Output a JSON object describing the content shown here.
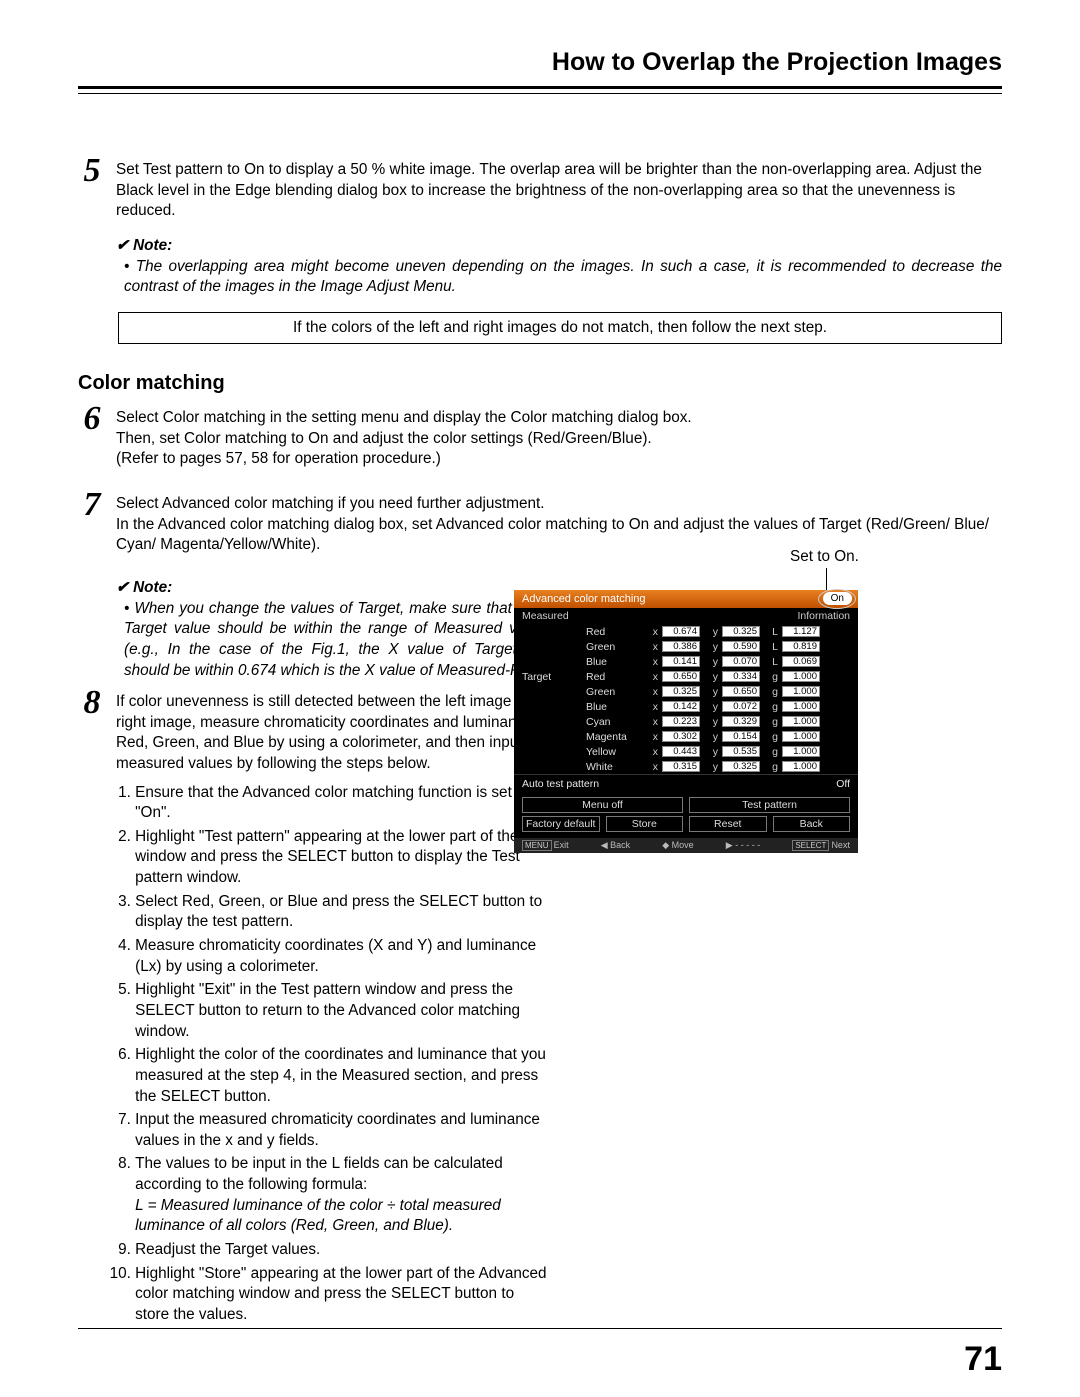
{
  "header": {
    "title": "How to Overlap the Projection Images"
  },
  "page_number": "71",
  "step5": {
    "num": "5",
    "body": "Set Test pattern to On to display a 50 % white image. The overlap area will be brighter than the non-overlapping area. Adjust the Black level in the Edge blending dialog box to increase the brightness of the non-overlapping area so that the unevenness is reduced."
  },
  "note5": {
    "heading": "Note:",
    "body": "The overlapping area might become uneven depending on the images. In such a case, it is recommended to decrease the contrast of the images in the Image Adjust Menu."
  },
  "boxed": "If the colors of the left and right images do not match, then follow the next step.",
  "section_color": "Color matching",
  "step6": {
    "num": "6",
    "body1": "Select Color matching in the setting menu and display the Color matching dialog box.",
    "body2": "Then, set Color matching to On and adjust the color settings (Red/Green/Blue).",
    "body3": "(Refer to pages 57, 58 for operation procedure.)"
  },
  "step7": {
    "num": "7",
    "body1": "Select Advanced color matching if you need further adjustment.",
    "body2": "In the Advanced color matching dialog box, set Advanced color matching to On and adjust the values of Target (Red/Green/ Blue/ Cyan/ Magenta/Yellow/White)."
  },
  "note7": {
    "heading": "Note:",
    "body": "When you change the values of Target, make sure that each Target value should be within the range of Measured value. (e.g., In the case of the Fig.1, the X value of Target-Red should be within 0.674 which is the X value of Measured-Red.)"
  },
  "step8": {
    "num": "8",
    "intro": "If color unevenness is still detected between the left image and right image, measure chromaticity coordinates and luminance of Red, Green, and Blue by using a colorimeter, and then input the measured values by following the steps below.",
    "list": [
      "Ensure that the Advanced color matching function is set to \"On\".",
      "Highlight \"Test pattern\" appearing at the lower part of the window and press the SELECT button to display the Test pattern window.",
      "Select Red, Green, or Blue and press the SELECT button to display the test pattern.",
      "Measure chromaticity coordinates (X and Y) and luminance (Lx) by using a colorimeter.",
      "Highlight \"Exit\" in the Test pattern window and press the SELECT button to return to the Advanced color matching window.",
      "Highlight the color of the coordinates and luminance that you measured at the step 4, in the Measured section, and press the SELECT button.",
      "Input the measured chromaticity coordinates and luminance values in the x and y fields.",
      "The values to be input in the L fields can be calculated according to the following formula:",
      "Readjust the Target values.",
      "Highlight \"Store\" appearing at the lower part of the Advanced color matching window and press the SELECT button to store the values."
    ],
    "formula": "L = Measured luminance of the color ÷ total measured luminance of all colors (Red, Green, and Blue)."
  },
  "figure": {
    "set_on": "Set to On.",
    "title": "Advanced color matching",
    "on_label": "On",
    "sub_left": "Measured",
    "sub_right": "Information",
    "measured": [
      {
        "name": "Red",
        "x": "0.674",
        "y": "0.325",
        "lab": "L",
        "l": "1.127"
      },
      {
        "name": "Green",
        "x": "0.386",
        "y": "0.590",
        "lab": "L",
        "l": "0.819"
      },
      {
        "name": "Blue",
        "x": "0.141",
        "y": "0.070",
        "lab": "L",
        "l": "0.069"
      }
    ],
    "target_label": "Target",
    "target": [
      {
        "name": "Red",
        "x": "0.650",
        "y": "0.334",
        "lab": "g",
        "l": "1.000"
      },
      {
        "name": "Green",
        "x": "0.325",
        "y": "0.650",
        "lab": "g",
        "l": "1.000"
      },
      {
        "name": "Blue",
        "x": "0.142",
        "y": "0.072",
        "lab": "g",
        "l": "1.000"
      },
      {
        "name": "Cyan",
        "x": "0.223",
        "y": "0.329",
        "lab": "g",
        "l": "1.000"
      },
      {
        "name": "Magenta",
        "x": "0.302",
        "y": "0.154",
        "lab": "g",
        "l": "1.000"
      },
      {
        "name": "Yellow",
        "x": "0.443",
        "y": "0.535",
        "lab": "g",
        "l": "1.000"
      },
      {
        "name": "White",
        "x": "0.315",
        "y": "0.325",
        "lab": "g",
        "l": "1.000"
      }
    ],
    "auto_test_label": "Auto test pattern",
    "auto_test_value": "Off",
    "buttons": {
      "menu_off": "Menu off",
      "test_pattern": "Test pattern",
      "factory_default": "Factory default",
      "store": "Store",
      "reset": "Reset",
      "back": "Back"
    },
    "nav": {
      "exit": "Exit",
      "back": "Back",
      "move": "Move",
      "dash": "- - - - -",
      "next": "Next"
    }
  }
}
